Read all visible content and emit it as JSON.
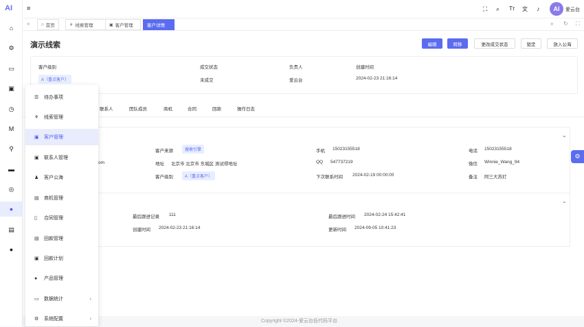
{
  "brand": {
    "logo": "AI",
    "accent": "#5b6cf0"
  },
  "header": {
    "username": "爱云台",
    "avatar": "AI"
  },
  "tabs": [
    {
      "label": "首页",
      "icon": "home-icon"
    },
    {
      "label": "线索管理",
      "icon": "tag-icon"
    },
    {
      "label": "客户管理",
      "icon": "customer-icon"
    },
    {
      "label": "客户详情",
      "icon": ""
    }
  ],
  "page": {
    "title": "演示线索",
    "actions": [
      "编辑",
      "转移",
      "更改成交状态",
      "锁定",
      "放入公海"
    ]
  },
  "summary": {
    "labels": [
      "客户级别",
      "成交状态",
      "负责人",
      "创建时间"
    ],
    "level_tag": "A（重点客户）",
    "deal_status": "未成交",
    "owner": "爱云台",
    "created": "2024-02-23 21:16:14"
  },
  "subtabs": [
    "联系人",
    "团队成员",
    "商机",
    "合同",
    "回款",
    "操作日志"
  ],
  "detail": {
    "partial_email": "om",
    "source_label": "客户来源",
    "source_tag": "搜索引擎",
    "address_label": "地址",
    "address": "北京市 北京市 东城区 测试得地址",
    "level_label": "客户级别",
    "level_tag": "A（重点客户）",
    "mobile_label": "手机",
    "mobile": "15023155518",
    "qq_label": "QQ",
    "qq": "547737219",
    "next_label": "下次联系时间",
    "next": "2024-02-19 00:00:00",
    "phone_label": "电话",
    "phone": "15023155518",
    "wechat_label": "微信",
    "wechat": "Winnie_Wang_94",
    "remark_label": "备注",
    "remark": "阿三大苏打"
  },
  "system": {
    "last_record_label": "最后跟进记录",
    "last_record": "111",
    "created_label": "创建时间",
    "created": "2024-02-23 21:16:14",
    "last_time_label": "最后跟进时间",
    "last_time": "2024-02-24 15:42:41",
    "updated_label": "更新时间",
    "updated": "2024-09-05 10:41:23"
  },
  "menu": [
    {
      "label": "待办事项",
      "icon": "todo-list-icon"
    },
    {
      "label": "线索管理",
      "icon": "tag-icon"
    },
    {
      "label": "客户管理",
      "icon": "customer-icon",
      "active": true
    },
    {
      "label": "联系人管理",
      "icon": "contact-icon"
    },
    {
      "label": "客户公海",
      "icon": "pool-icon"
    },
    {
      "label": "商机管理",
      "icon": "bus-icon"
    },
    {
      "label": "合同管理",
      "icon": "contract-icon"
    },
    {
      "label": "回款管理",
      "icon": "payment-icon"
    },
    {
      "label": "回款计划",
      "icon": "plan-icon"
    },
    {
      "label": "产品管理",
      "icon": "product-icon"
    },
    {
      "label": "数据统计",
      "icon": "stats-icon",
      "arrow": true
    },
    {
      "label": "系统配置",
      "icon": "settings-icon",
      "arrow": true
    }
  ],
  "footer": "Copyright ©2024-爱云台低代码平台"
}
